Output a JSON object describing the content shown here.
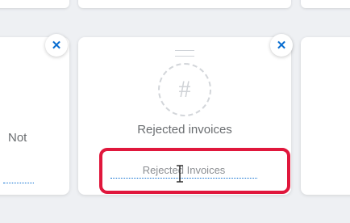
{
  "tiles": {
    "left": {
      "visible_text": "Not",
      "remove_icon": "close-icon"
    },
    "main": {
      "placeholder_icon": "hash-icon",
      "placeholder_glyph": "#",
      "title": "Rejected invoices",
      "title_input_value": "Rejected Invoices",
      "remove_icon": "close-icon",
      "drag_icon": "drag-handle-icon"
    }
  },
  "icons": {
    "close": "✕",
    "cursor": "text-cursor-icon"
  },
  "colors": {
    "accent": "#0a6ed1",
    "highlight": "#e0173c",
    "background": "#eef0f3"
  }
}
